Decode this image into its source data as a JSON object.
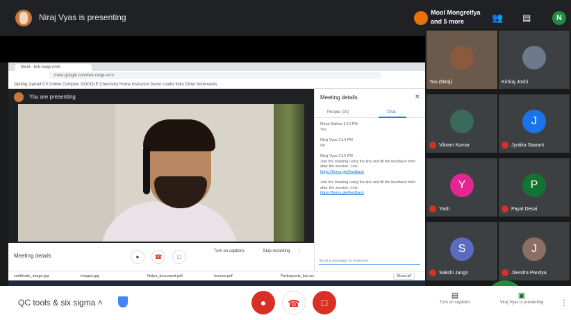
{
  "topbar": {
    "presenter_text": "Niraj Vyas is presenting",
    "self_label": "Mool Mongrelfya and 5 more",
    "self_avatar_letter": "N",
    "people_icon": "people-icon",
    "chat_icon": "chat-icon"
  },
  "browser": {
    "tab_label": "Meet - bxk-rwqp-onm",
    "address": "meet.google.com/bxk-rwqp-onm",
    "bookmarks": "Getting started   CV  Online Compiler   GOOGLE  Chemistry Home   Instructor   Demo   Useful links   Other bookmarks"
  },
  "inner_meet": {
    "header_text": "You are presenting",
    "meeting_details": "Meeting details",
    "turn_on_captions": "Turn on captions",
    "present_now": "Present now",
    "stop_recording": "Stop recording"
  },
  "chat_panel": {
    "title": "Meeting details",
    "tab_people": "People (10)",
    "tab_chat": "Chat",
    "messages": [
      {
        "sender": "Minal Mathur 3:14 PM",
        "text": "Yes"
      },
      {
        "sender": "Niraj Vyas 3:14 PM",
        "text": "Ok"
      },
      {
        "sender": "Niraj Vyas 3:15 PM",
        "text": "Join the meeting using the link and fill the feedback form after the session. Link:",
        "link": "https://forms.gle/feedback"
      },
      {
        "sender": "",
        "text": "Join the meeting using the link and fill the feedback form after the session. Link:",
        "link": "https://forms.gle/feedback"
      }
    ],
    "input_placeholder": "Send a message to everyone"
  },
  "downloads": {
    "items": [
      "certificate_image.jpg",
      "images.jpg",
      "Notes_document.pdf",
      "Invoice.pdf",
      "Participants_list.csv"
    ],
    "show_all": "Show all"
  },
  "participants": [
    {
      "name": "You (Niraj)",
      "type": "photo",
      "color": "#8a5a3c",
      "muted": false
    },
    {
      "name": "Kirtiraj Joshi",
      "type": "photo",
      "color": "#6d7a8c",
      "muted": false
    },
    {
      "name": "Vikram Kumar",
      "type": "photo",
      "color": "#3a6a5a",
      "muted": true
    },
    {
      "name": "Jyotika Sawant",
      "type": "letter",
      "letter": "J",
      "color": "#1a73e8",
      "muted": true
    },
    {
      "name": "Yash",
      "type": "letter",
      "letter": "Y",
      "color": "#e52592",
      "muted": true
    },
    {
      "name": "Payal Desai",
      "type": "letter",
      "letter": "P",
      "color": "#137333",
      "muted": true
    },
    {
      "name": "Sakshi Jangir",
      "type": "letter",
      "letter": "S",
      "color": "#5c6bc0",
      "muted": true
    },
    {
      "name": "Jitendra Pandya",
      "type": "letter",
      "letter": "J",
      "color": "#8d6e63",
      "muted": true
    }
  ],
  "bottombar": {
    "meeting_name": "QC tools & six sigma",
    "turn_on_captions": "Turn on captions",
    "present_label": "Viraj Vyas is presenting"
  }
}
